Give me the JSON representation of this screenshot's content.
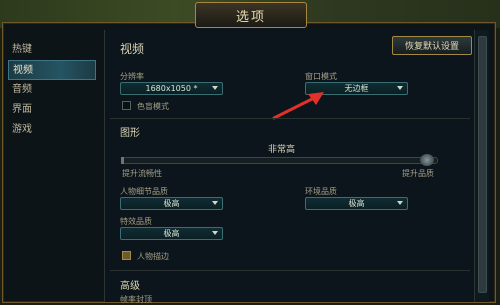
{
  "window": {
    "title": "选项"
  },
  "sidebar": {
    "items": [
      {
        "label": "热键"
      },
      {
        "label": "视频"
      },
      {
        "label": "音频"
      },
      {
        "label": "界面"
      },
      {
        "label": "游戏"
      }
    ],
    "active": "视频"
  },
  "reset_button": {
    "label": "恢复默认设置"
  },
  "video": {
    "title": "视频",
    "resolution": {
      "label": "分辨率",
      "value": "1680x1050 *"
    },
    "window_mode": {
      "label": "窗口模式",
      "value": "无边框"
    },
    "colorblind": {
      "label": "色盲模式",
      "checked": false
    }
  },
  "graphics": {
    "title": "图形",
    "quality_value": "非常高",
    "quality_level": 1.0,
    "left_label": "提升流畅性",
    "right_label": "提升品质",
    "character_quality": {
      "label": "人物细节品质",
      "value": "极高"
    },
    "environment_quality": {
      "label": "环境品质",
      "value": "极高"
    },
    "effects_quality": {
      "label": "特效品质",
      "value": "极高"
    },
    "character_outline": {
      "label": "人物描边",
      "checked": true
    }
  },
  "advanced": {
    "title": "高级",
    "frame_rate_label": "帧率封顶"
  },
  "colors": {
    "accent_gold": "#a8883f",
    "dropdown_border": "#3b6e72",
    "annotation_red": "#e0312a"
  }
}
